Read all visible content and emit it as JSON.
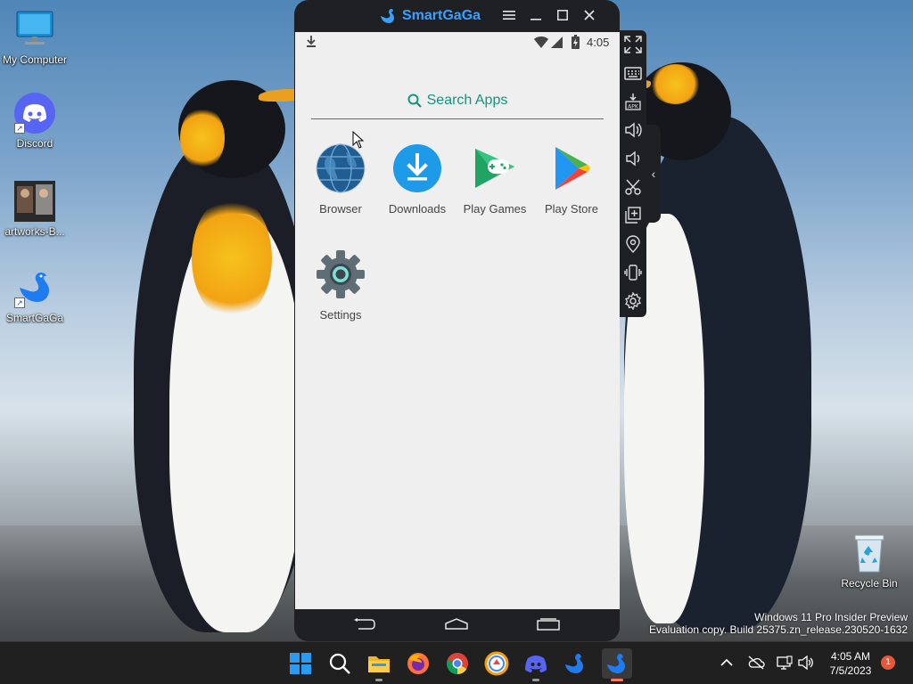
{
  "desktop": {
    "icons": [
      {
        "label": "My Computer"
      },
      {
        "label": "Discord"
      },
      {
        "label": "artworks-B..."
      },
      {
        "label": "SmartGaGa"
      },
      {
        "label": "Recycle Bin"
      }
    ],
    "watermark": {
      "line1": "Windows 11 Pro Insider Preview",
      "line2": "Evaluation copy. Build 25375.zn_release.230520-1632"
    }
  },
  "emulator": {
    "title": "SmartGaGa",
    "status": {
      "time": "4:05"
    },
    "search": {
      "label": "Search Apps"
    },
    "apps": [
      {
        "label": "Browser",
        "icon": "browser-globe"
      },
      {
        "label": "Downloads",
        "icon": "download-arrow"
      },
      {
        "label": "Play Games",
        "icon": "gamepad"
      },
      {
        "label": "Play Store",
        "icon": "play-triangle"
      },
      {
        "label": "Settings",
        "icon": "gear"
      }
    ]
  },
  "side_toolbar": [
    "fullscreen",
    "keyboard",
    "install-apk",
    "volume-up",
    "volume-down",
    "screenshot-cut",
    "multi-instance",
    "location",
    "shake",
    "settings"
  ],
  "taskbar": {
    "apps": [
      "start",
      "search",
      "file-explorer",
      "firefox",
      "chrome",
      "brave",
      "discord",
      "smartgaga",
      "smartgaga-active"
    ],
    "clock_time": "4:05 AM",
    "clock_date": "7/5/2023",
    "notification_count": "1"
  },
  "colors": {
    "accent": "#17937f",
    "taskbar": "#202020",
    "emulator_frame": "#1f2023",
    "brand_blue": "#3aa0ff"
  }
}
